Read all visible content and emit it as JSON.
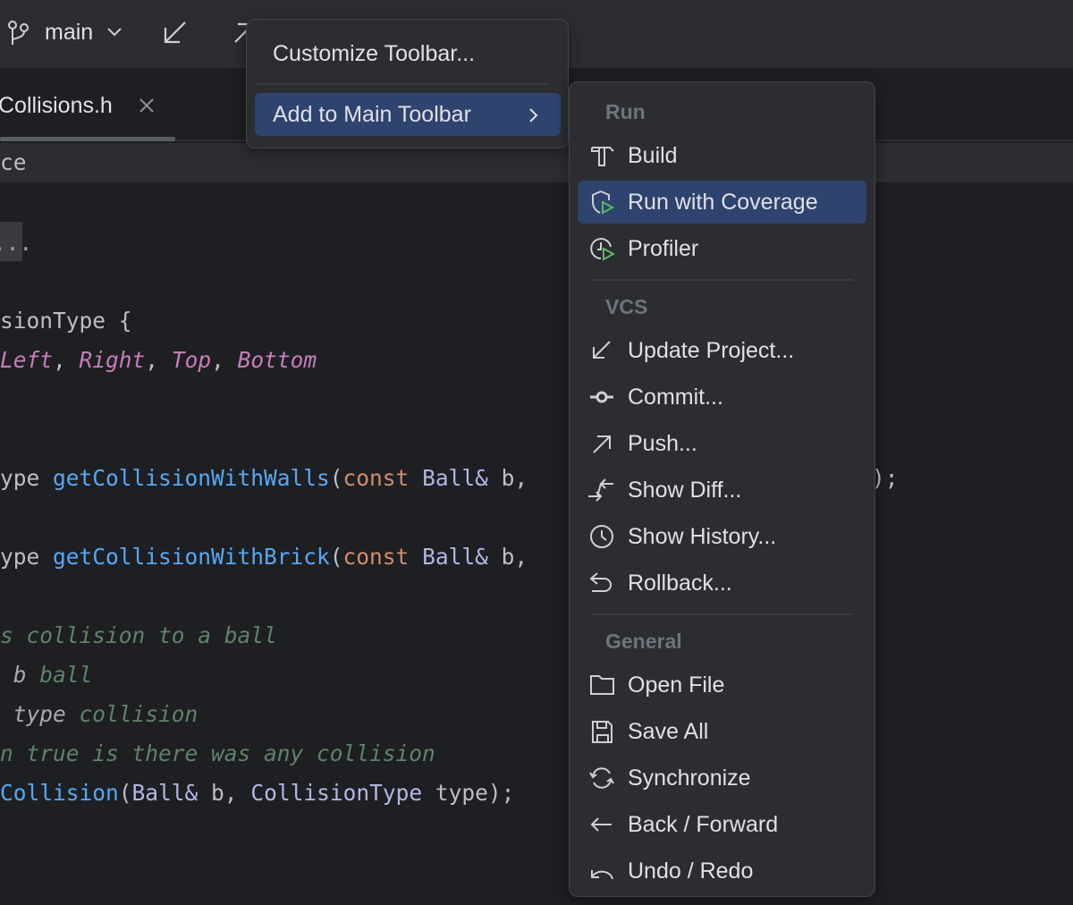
{
  "toolbar": {
    "branch": "main",
    "icons": [
      "git-branch-icon",
      "chevron-down-icon",
      "update-arrow-icon",
      "push-arrow-icon"
    ]
  },
  "tab": {
    "label": "Collisions.h"
  },
  "breadcrumb": {
    "text": "ce"
  },
  "fold": {
    "text": "..."
  },
  "code": [
    [
      {
        "t": "sionType ",
        "c": "#bcbec4"
      },
      {
        "t": "{",
        "c": "#bcbec4"
      }
    ],
    [
      {
        "t": "Left",
        "c": "#c77dbb",
        "i": 1
      },
      {
        "t": ", ",
        "c": "#bcbec4"
      },
      {
        "t": "Right",
        "c": "#c77dbb",
        "i": 1
      },
      {
        "t": ", ",
        "c": "#bcbec4"
      },
      {
        "t": "Top",
        "c": "#c77dbb",
        "i": 1
      },
      {
        "t": ", ",
        "c": "#bcbec4"
      },
      {
        "t": "Bottom",
        "c": "#c77dbb",
        "i": 1
      }
    ],
    [
      {
        "t": "ype ",
        "c": "#bcbec4"
      },
      {
        "t": "getCollisionWithWalls",
        "c": "#56a8f5"
      },
      {
        "t": "(",
        "c": "#bcbec4"
      },
      {
        "t": "const ",
        "c": "#cf8e6d"
      },
      {
        "t": "Ball&",
        "c": "#b5b6e3"
      },
      {
        "t": " b,",
        "c": "#bcbec4"
      }
    ],
    [
      {
        "t": "ype ",
        "c": "#bcbec4"
      },
      {
        "t": "getCollisionWithBrick",
        "c": "#56a8f5"
      },
      {
        "t": "(",
        "c": "#bcbec4"
      },
      {
        "t": "const ",
        "c": "#cf8e6d"
      },
      {
        "t": "Ball&",
        "c": "#b5b6e3"
      },
      {
        "t": " b,",
        "c": "#bcbec4"
      }
    ],
    [
      {
        "t": "s collision to a ball",
        "c": "#5f826b",
        "i": 1
      }
    ],
    [
      {
        "t": " b",
        "c": "#a8aab0",
        "i": 1
      },
      {
        "t": " ball",
        "c": "#5f826b",
        "i": 1
      }
    ],
    [
      {
        "t": " type",
        "c": "#a8aab0",
        "i": 1
      },
      {
        "t": " collision",
        "c": "#5f826b",
        "i": 1
      }
    ],
    [
      {
        "t": "n true is there was any collision",
        "c": "#5f826b",
        "i": 1
      }
    ],
    [
      {
        "t": "Collision",
        "c": "#56a8f5"
      },
      {
        "t": "(",
        "c": "#bcbec4"
      },
      {
        "t": "Ball&",
        "c": "#b5b6e3"
      },
      {
        "t": " b, ",
        "c": "#bcbec4"
      },
      {
        "t": "CollisionType",
        "c": "#b5b6e3"
      },
      {
        "t": " type);",
        "c": "#bcbec4"
      }
    ]
  ],
  "code_overflow": ");",
  "context_menu": {
    "items": [
      {
        "label": "Customize Toolbar..."
      },
      {
        "label": "Add to Main Toolbar",
        "selected": true,
        "submenu": true
      }
    ]
  },
  "submenu": {
    "sections": [
      {
        "header": "Run",
        "items": [
          {
            "label": "Build",
            "icon": "hammer-icon"
          },
          {
            "label": "Run with Coverage",
            "icon": "coverage-icon",
            "selected": true
          },
          {
            "label": "Profiler",
            "icon": "profiler-icon"
          }
        ]
      },
      {
        "header": "VCS",
        "items": [
          {
            "label": "Update Project...",
            "icon": "update-icon"
          },
          {
            "label": "Commit...",
            "icon": "commit-icon"
          },
          {
            "label": "Push...",
            "icon": "push-icon"
          },
          {
            "label": "Show Diff...",
            "icon": "diff-icon"
          },
          {
            "label": "Show History...",
            "icon": "history-icon"
          },
          {
            "label": "Rollback...",
            "icon": "rollback-icon"
          }
        ]
      },
      {
        "header": "General",
        "items": [
          {
            "label": "Open File",
            "icon": "folder-icon"
          },
          {
            "label": "Save All",
            "icon": "save-icon"
          },
          {
            "label": "Synchronize",
            "icon": "sync-icon"
          },
          {
            "label": "Back / Forward",
            "icon": "back-arrow-icon"
          },
          {
            "label": "Undo / Redo",
            "icon": "undo-icon"
          }
        ]
      }
    ]
  },
  "colors": {
    "selection": "#2e436e",
    "run_green": "#5fb865",
    "panel": "#2b2d30",
    "editor": "#1e1f22"
  }
}
